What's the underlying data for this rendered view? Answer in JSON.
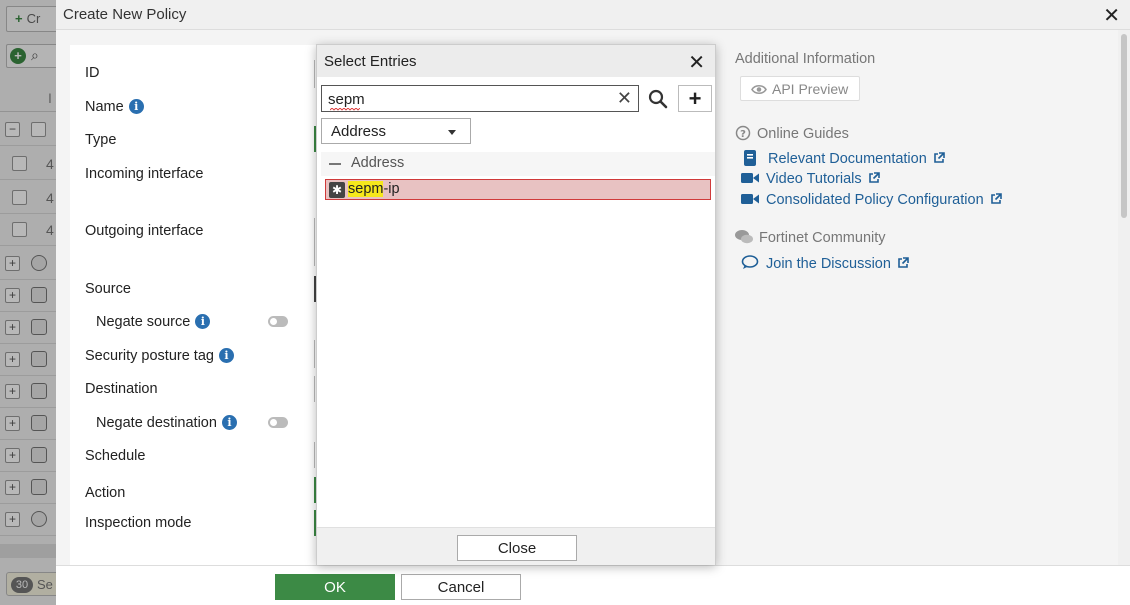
{
  "background": {
    "create_label": "Cr",
    "column_header": "I",
    "row_numbers": [
      "4",
      "4",
      "4"
    ],
    "badge_count": "30",
    "badge_label": "Se"
  },
  "dialog": {
    "title": "Create New Policy",
    "close_glyph": "✕"
  },
  "form": {
    "id_label": "ID",
    "name_label": "Name",
    "type_label": "Type",
    "incoming_label": "Incoming interface",
    "outgoing_label": "Outgoing interface",
    "source_label": "Source",
    "negate_source_label": "Negate source",
    "posture_label": "Security posture tag",
    "destination_label": "Destination",
    "negate_destination_label": "Negate destination",
    "schedule_label": "Schedule",
    "action_label": "Action",
    "inspection_label": "Inspection mode",
    "info_glyph": "i"
  },
  "side": {
    "additional_heading": "Additional Information",
    "api_preview": "API Preview",
    "online_guides_heading": "Online Guides",
    "links": {
      "docs": "Relevant Documentation",
      "videos": "Video Tutorials",
      "consolidated": "Consolidated Policy Configuration",
      "discussion": "Join the Discussion"
    },
    "community_heading": "Fortinet Community"
  },
  "footer": {
    "ok": "OK",
    "cancel": "Cancel"
  },
  "popover": {
    "title": "Select Entries",
    "close_glyph": "✕",
    "search_value": "sepm",
    "clear_glyph": "✕",
    "add_glyph": "+",
    "type_selected": "Address",
    "group_label": "Address",
    "entry_match": "sepm",
    "entry_rest": "-ip",
    "close_button": "Close"
  },
  "colors": {
    "ok_green": "#3c8a45",
    "link_blue": "#1f5f97",
    "info_blue": "#2a6fb0",
    "selected_bg": "#e8c2c2",
    "selected_border": "#d03a3a",
    "highlight_yellow": "#f6e81b"
  },
  "icons": [
    "plus-icon",
    "search-icon",
    "info-icon",
    "toggle-icon",
    "eye-icon",
    "question-circle-icon",
    "book-icon",
    "video-camera-icon",
    "external-link-icon",
    "chat-bubbles-icon",
    "chat-bubble-icon",
    "close-icon",
    "clear-icon",
    "caret-down-icon",
    "address-object-icon"
  ]
}
